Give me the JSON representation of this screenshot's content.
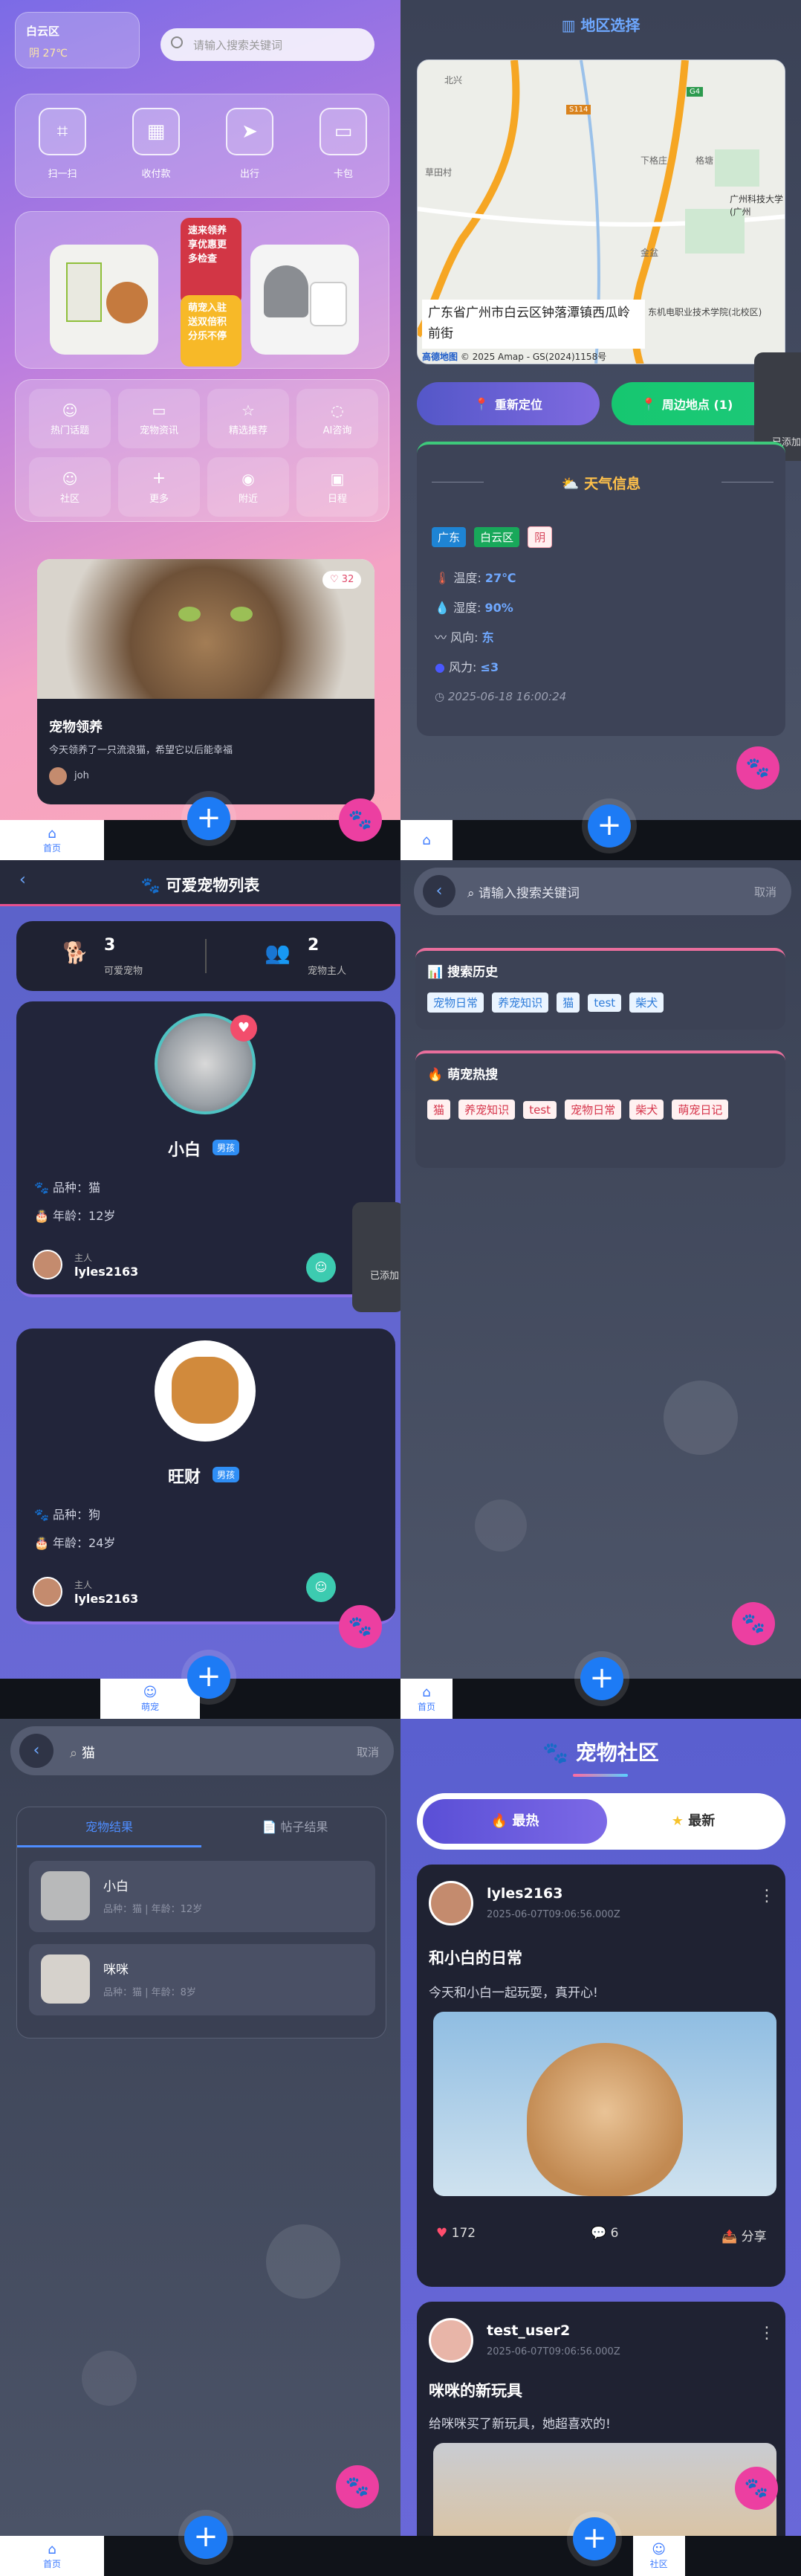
{
  "p1": {
    "location": "白云区",
    "weather": "阴 27℃",
    "search_placeholder": "请输入搜索关键词",
    "quick": [
      {
        "label": "扫一扫"
      },
      {
        "label": "收付款"
      },
      {
        "label": "出行"
      },
      {
        "label": "卡包"
      }
    ],
    "promo1": "速来领养享优惠更多检查",
    "promo2": "萌宠入驻送双倍积分乐不停",
    "grid": [
      {
        "label": "热门话题"
      },
      {
        "label": "宠物资讯"
      },
      {
        "label": "精选推荐"
      },
      {
        "label": "AI咨询"
      },
      {
        "label": "社区"
      },
      {
        "label": "更多"
      },
      {
        "label": "附近"
      },
      {
        "label": "日程"
      }
    ],
    "post": {
      "likes": "32",
      "title": "宠物领养",
      "desc": "今天领养了一只流浪猫，希望它以后能幸福",
      "user": "joh"
    },
    "tab_home": "首页"
  },
  "p2": {
    "title": "地区选择",
    "address": "广东省广州市白云区钟落潭镇西瓜岭前街",
    "map_credit": "© 2025 Amap - GS(2024)1158号",
    "map_brand": "高德地图",
    "map_labels": {
      "a": "北兴",
      "b": "草田村",
      "c": "格塘",
      "d": "广州科技大学(广州",
      "e": "东机电职业技术学院(北校区)",
      "f": "下格庄",
      "g": "金盆",
      "h": "G4",
      "i": "S114"
    },
    "btn_relocate": "重新定位",
    "btn_nearby": "周边地点 (1)",
    "side_toast": "已添加",
    "weather_title": "天气信息",
    "tags": [
      "广东",
      "白云区",
      "阴"
    ],
    "rows": [
      {
        "k": "温度: ",
        "v": "27℃"
      },
      {
        "k": "湿度: ",
        "v": "90%"
      },
      {
        "k": "风向: ",
        "v": "东"
      },
      {
        "k": "风力: ",
        "v": "≤3"
      }
    ],
    "time": "2025-06-18 16:00:24"
  },
  "p3": {
    "title": "可爱宠物列表",
    "stats": [
      {
        "num": "3",
        "label": "可爱宠物"
      },
      {
        "num": "2",
        "label": "宠物主人"
      }
    ],
    "pets": [
      {
        "name": "小白",
        "gender": "男孩",
        "breed": "品种：猫",
        "age": "年龄：12岁",
        "owner_label": "主人",
        "owner": "lyles2163"
      },
      {
        "name": "旺财",
        "gender": "男孩",
        "breed": "品种：狗",
        "age": "年龄：24岁",
        "owner_label": "主人",
        "owner": "lyles2163"
      }
    ],
    "toast": "已添加",
    "tab_active": "萌宠"
  },
  "p4": {
    "search_placeholder": "请输入搜索关键词",
    "cancel": "取消",
    "history_title": "搜索历史",
    "history": [
      "宠物日常",
      "养宠知识",
      "猫",
      "test",
      "柴犬"
    ],
    "hot_title": "萌宠热搜",
    "hot": [
      "猫",
      "养宠知识",
      "test",
      "宠物日常",
      "柴犬",
      "萌宠日记"
    ],
    "tab_home": "首页"
  },
  "p5": {
    "query": "猫",
    "cancel": "取消",
    "tab1": "宠物结果",
    "tab2": "帖子结果",
    "results": [
      {
        "name": "小白",
        "meta": "品种：猫 | 年龄：12岁"
      },
      {
        "name": "咪咪",
        "meta": "品种：猫 | 年龄：8岁"
      }
    ],
    "tab_home": "首页"
  },
  "p6": {
    "title": "宠物社区",
    "tab_hot": "最热",
    "tab_new": "最新",
    "posts": [
      {
        "user": "lyles2163",
        "time": "2025-06-07T09:06:56.000Z",
        "title": "和小白的日常",
        "desc": "今天和小白一起玩耍，真开心!",
        "likes": "172",
        "comments": "6",
        "share": "分享"
      },
      {
        "user": "test_user2",
        "time": "2025-06-07T09:06:56.000Z",
        "title": "咪咪的新玩具",
        "desc": "给咪咪买了新玩具，她超喜欢的!"
      }
    ],
    "tab_active": "社区"
  }
}
